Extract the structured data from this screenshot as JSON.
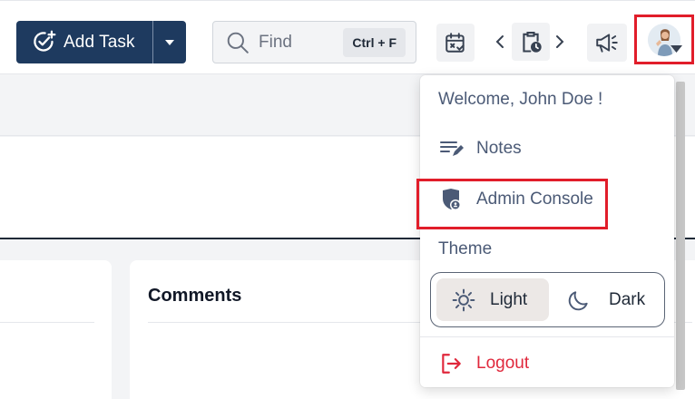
{
  "toolbar": {
    "add_task_label": "Add Task",
    "find_placeholder": "Find",
    "find_shortcut": "Ctrl + F"
  },
  "comments": {
    "title": "Comments"
  },
  "user_menu": {
    "welcome": "Welcome, John Doe !",
    "items": [
      {
        "label": "Notes",
        "icon": "notes-icon"
      },
      {
        "label": "Admin Console",
        "icon": "shield-user-icon"
      }
    ],
    "theme_label": "Theme",
    "theme_options": [
      {
        "label": "Light",
        "icon": "sun-icon",
        "selected": true
      },
      {
        "label": "Dark",
        "icon": "moon-icon",
        "selected": false
      }
    ],
    "logout_label": "Logout"
  },
  "colors": {
    "primary": "#1e3a5f",
    "highlight": "#e11d2a",
    "menu_text": "#4b5a76",
    "logout": "#e0283c"
  }
}
